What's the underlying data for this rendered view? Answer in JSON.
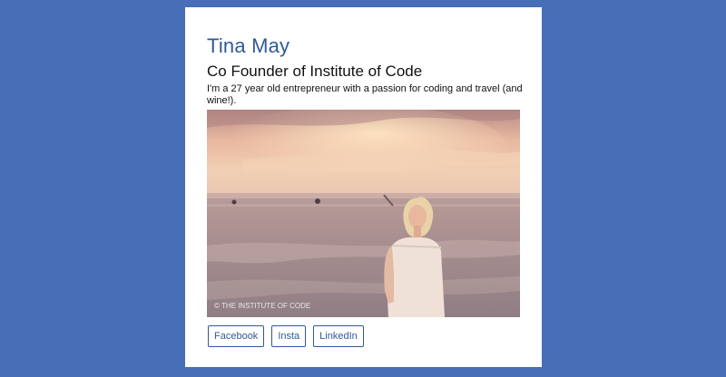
{
  "profile": {
    "name": "Tina May",
    "title": "Co Founder of Institute of Code",
    "bio": "I'm a 27 year old entrepreneur with a passion for coding and travel (and wine!).",
    "photo_watermark": "© THE INSTITUTE OF CODE"
  },
  "socials": [
    {
      "label": "Facebook"
    },
    {
      "label": "Insta"
    },
    {
      "label": "LinkedIn"
    }
  ],
  "colors": {
    "background": "#476eb6",
    "card": "#ffffff",
    "accent": "#2f5a97"
  }
}
